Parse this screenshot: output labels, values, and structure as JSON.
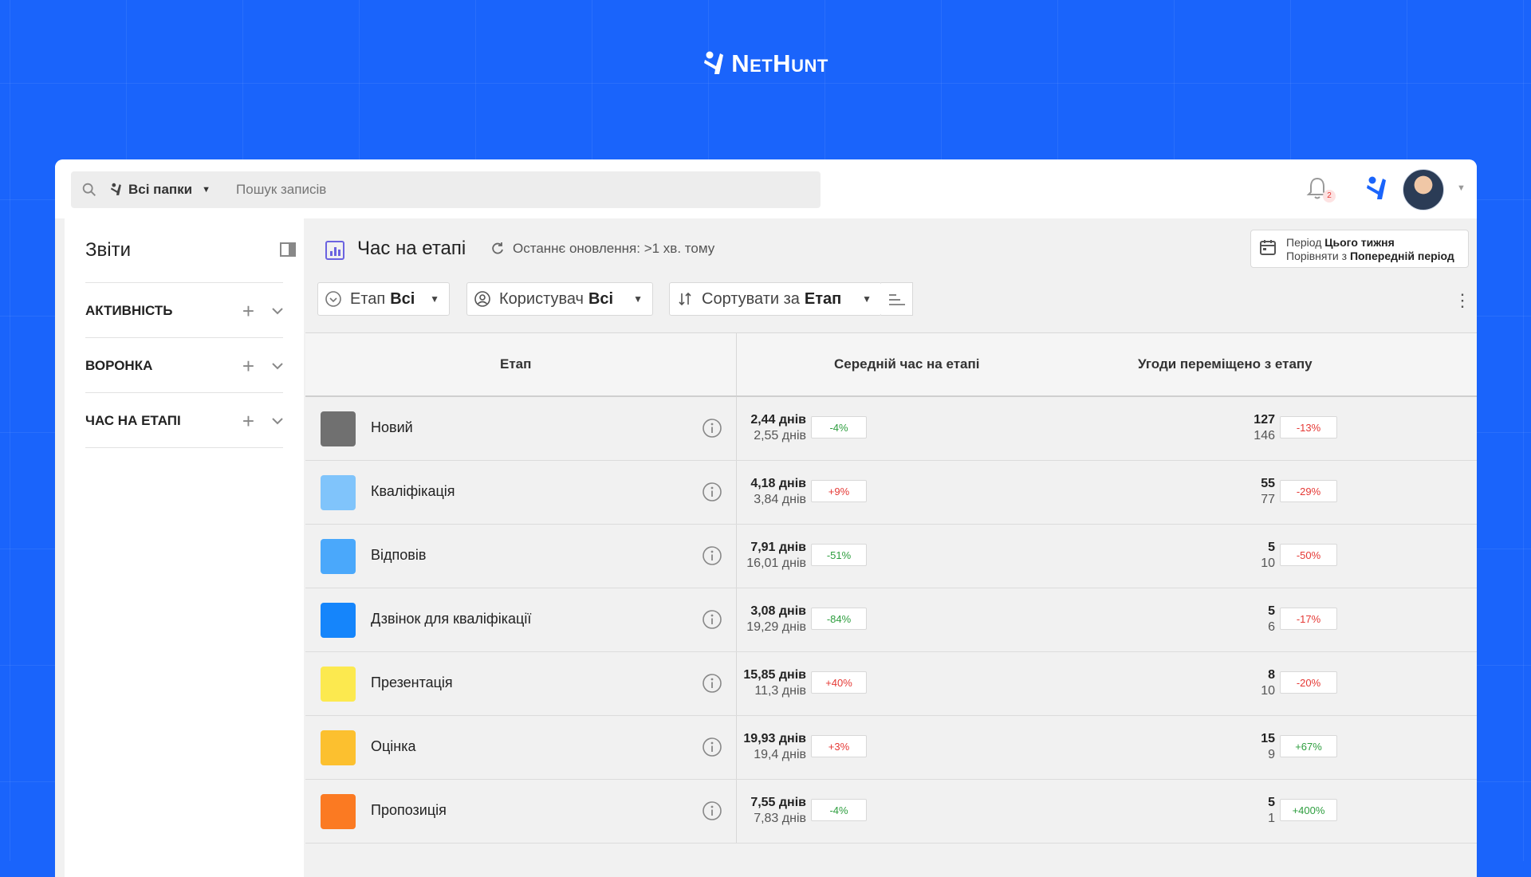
{
  "brand": {
    "name": "NetHunt"
  },
  "topbar": {
    "folder_label": "Всі папки",
    "search_placeholder": "Пошук записів",
    "notifications_count": "2"
  },
  "sidebar": {
    "title": "Звіти",
    "sections": [
      {
        "label": "АКТИВНІСТЬ"
      },
      {
        "label": "ВОРОНКА"
      },
      {
        "label": "ЧАС НА ЕТАПІ"
      }
    ]
  },
  "report": {
    "title": "Час на етапі",
    "last_update": "Останнє оновлення: >1 хв. тому",
    "period_label": "Період",
    "period_value": "Цього тижня",
    "compare_label": "Порівняти з",
    "compare_value": "Попередній період"
  },
  "filters": {
    "stage_label": "Етап",
    "stage_value": "Всі",
    "user_label": "Користувач",
    "user_value": "Всі",
    "sort_label": "Сортувати за",
    "sort_value": "Етап"
  },
  "table": {
    "headers": {
      "stage": "Етап",
      "avg_time": "Середній час на етапі",
      "moved": "Угоди переміщено з етапу"
    },
    "rows": [
      {
        "stage": "Новий",
        "color": "#707070",
        "time_cur": "2,44 днів",
        "time_prev": "2,55 днів",
        "time_pct": "-4%",
        "time_pct_type": "pos",
        "moved_cur": "127",
        "moved_prev": "146",
        "moved_pct": "-13%",
        "moved_pct_type": "neg"
      },
      {
        "stage": "Кваліфікація",
        "color": "#80c4fb",
        "time_cur": "4,18 днів",
        "time_prev": "3,84 днів",
        "time_pct": "+9%",
        "time_pct_type": "neg",
        "moved_cur": "55",
        "moved_prev": "77",
        "moved_pct": "-29%",
        "moved_pct_type": "neg"
      },
      {
        "stage": "Відповів",
        "color": "#4aa8fb",
        "time_cur": "7,91 днів",
        "time_prev": "16,01 днів",
        "time_pct": "-51%",
        "time_pct_type": "pos",
        "moved_cur": "5",
        "moved_prev": "10",
        "moved_pct": "-50%",
        "moved_pct_type": "neg"
      },
      {
        "stage": "Дзвінок для кваліфікації",
        "color": "#1585fb",
        "time_cur": "3,08 днів",
        "time_prev": "19,29 днів",
        "time_pct": "-84%",
        "time_pct_type": "pos",
        "moved_cur": "5",
        "moved_prev": "6",
        "moved_pct": "-17%",
        "moved_pct_type": "neg"
      },
      {
        "stage": "Презентація",
        "color": "#fce94f",
        "time_cur": "15,85 днів",
        "time_prev": "11,3 днів",
        "time_pct": "+40%",
        "time_pct_type": "neg",
        "moved_cur": "8",
        "moved_prev": "10",
        "moved_pct": "-20%",
        "moved_pct_type": "neg"
      },
      {
        "stage": "Оцінка",
        "color": "#fcc02f",
        "time_cur": "19,93 днів",
        "time_prev": "19,4 днів",
        "time_pct": "+3%",
        "time_pct_type": "neg",
        "moved_cur": "15",
        "moved_prev": "9",
        "moved_pct": "+67%",
        "moved_pct_type": "pos"
      },
      {
        "stage": "Пропозиція",
        "color": "#fb7a22",
        "time_cur": "7,55 днів",
        "time_prev": "7,83 днів",
        "time_pct": "-4%",
        "time_pct_type": "pos",
        "moved_cur": "5",
        "moved_prev": "1",
        "moved_pct": "+400%",
        "moved_pct_type": "pos"
      }
    ]
  }
}
